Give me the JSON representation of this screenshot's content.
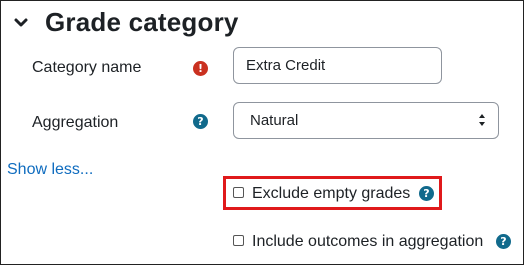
{
  "section": {
    "title": "Grade category",
    "chevron_icon": "chevron-down-icon"
  },
  "fields": {
    "category_name": {
      "label": "Category name",
      "value": "Extra Credit",
      "icon": "exclamation-circle-icon"
    },
    "aggregation": {
      "label": "Aggregation",
      "selected": "Natural",
      "icon": "question-circle-icon"
    }
  },
  "show_less": "Show less...",
  "checkboxes": {
    "exclude_empty": {
      "label": "Exclude empty grades",
      "checked": false
    },
    "include_outcomes": {
      "label": "Include outcomes in aggregation",
      "checked": false
    }
  },
  "colors": {
    "link": "#0f6cbf",
    "required": "#ca3120",
    "help": "#116a8c",
    "highlight": "#e0191b"
  }
}
